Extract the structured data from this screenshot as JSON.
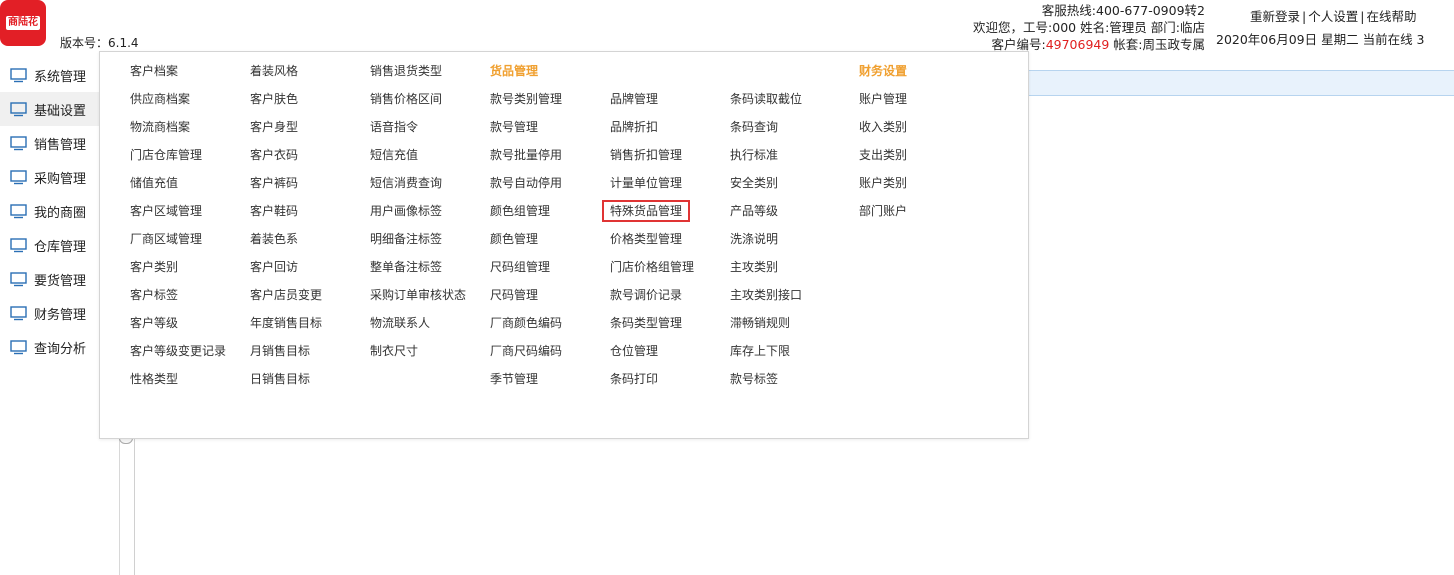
{
  "app": {
    "logo_text": "商陆花",
    "version": "版本号：6.1.4"
  },
  "header": {
    "hotline": "客服热线:400-677-0909转2",
    "welcome": "欢迎您，工号:000 姓名:管理员 部门:临店",
    "account_prefix": "客户编号:",
    "account_number": "49706949",
    "account_suffix": " 帐套:周玉政专属",
    "links": [
      "重新登录",
      "个人设置",
      "在线帮助"
    ],
    "date_line": "2020年06月09日 星期二 当前在线 3",
    "account_number_color": "#e02020"
  },
  "sidebar": {
    "items": [
      {
        "label": "系统管理",
        "icon": "monitor-icon"
      },
      {
        "label": "基础设置",
        "icon": "monitor-icon",
        "active": true
      },
      {
        "label": "销售管理",
        "icon": "monitor-icon"
      },
      {
        "label": "采购管理",
        "icon": "monitor-icon"
      },
      {
        "label": "我的商圈",
        "icon": "monitor-icon"
      },
      {
        "label": "仓库管理",
        "icon": "monitor-icon"
      },
      {
        "label": "要货管理",
        "icon": "monitor-icon"
      },
      {
        "label": "财务管理",
        "icon": "monitor-icon"
      },
      {
        "label": "查询分析",
        "icon": "monitor-icon"
      }
    ]
  },
  "menu": {
    "header_color": "#f0a030",
    "highlight_color": "#e03434",
    "columns": [
      {
        "items": [
          "客户档案",
          "供应商档案",
          "物流商档案",
          "门店仓库管理",
          "储值充值",
          "客户区域管理",
          "厂商区域管理",
          "客户类别",
          "客户标签",
          "客户等级",
          "客户等级变更记录",
          "性格类型"
        ]
      },
      {
        "items": [
          "着装风格",
          "客户肤色",
          "客户身型",
          "客户衣码",
          "客户裤码",
          "客户鞋码",
          "着装色系",
          "客户回访",
          "客户店员变更",
          "年度销售目标",
          "月销售目标",
          "日销售目标"
        ]
      },
      {
        "items": [
          "销售退货类型",
          "销售价格区间",
          "语音指令",
          "短信充值",
          "短信消费查询",
          "用户画像标签",
          "明细备注标签",
          "整单备注标签",
          "采购订单审核状态",
          "物流联系人",
          "制衣尺寸"
        ]
      },
      {
        "header": "货品管理",
        "items": [
          "款号类别管理",
          "款号管理",
          "款号批量停用",
          "款号自动停用",
          "颜色组管理",
          "颜色管理",
          "尺码组管理",
          "尺码管理",
          "厂商颜色编码",
          "厂商尺码编码",
          "季节管理"
        ]
      },
      {
        "items": [
          "品牌管理",
          "品牌折扣",
          "销售折扣管理",
          "计量单位管理",
          "特殊货品管理",
          "价格类型管理",
          "门店价格组管理",
          "款号调价记录",
          "条码类型管理",
          "仓位管理",
          "条码打印"
        ],
        "highlight_index": 4
      },
      {
        "items": [
          "条码读取截位",
          "条码查询",
          "执行标准",
          "安全类别",
          "产品等级",
          "洗涤说明",
          "主攻类别",
          "主攻类别接口",
          "滞畅销规则",
          "库存上下限",
          "款号标签"
        ]
      },
      {
        "header": "财务设置",
        "items": [
          "账户管理",
          "收入类别",
          "支出类别",
          "账户类别",
          "部门账户"
        ]
      }
    ]
  }
}
